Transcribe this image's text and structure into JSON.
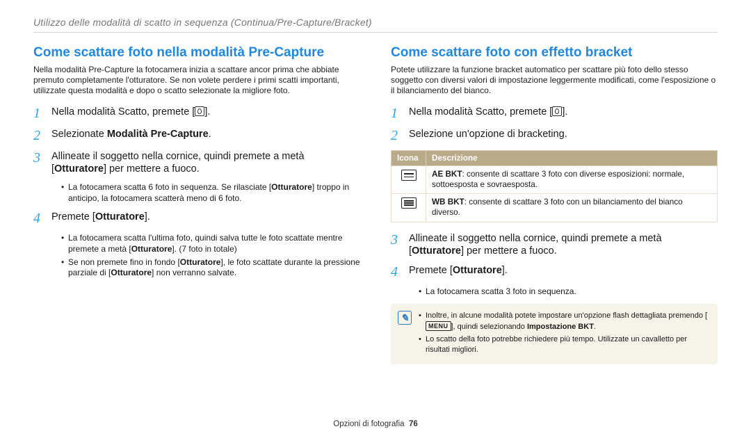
{
  "header": {
    "breadcrumb": "Utilizzo delle modalità di scatto in sequenza (Continua/Pre-Capture/Bracket)"
  },
  "left": {
    "title": "Come scattare foto nella modalità Pre-Capture",
    "intro": "Nella modalità Pre-Capture la fotocamera inizia a scattare ancor prima che abbiate premuto completamente l'otturatore. Se non volete perdere i primi scatti importanti, utilizzate questa modalità e dopo o scatto selezionate la migliore foto.",
    "steps": {
      "s1": {
        "n": "1",
        "a": "Nella modalità Scatto, premete [",
        "b": "]."
      },
      "s2": {
        "n": "2",
        "a": "Selezionate ",
        "b": "Modalità Pre-Capture",
        "c": "."
      },
      "s3": {
        "n": "3",
        "a": "Allineate il soggetto nella cornice, quindi premete a metà [",
        "b": "Otturatore",
        "c": "] per mettere a fuoco."
      },
      "s3_sub": {
        "i1_a": "La fotocamera scatta 6 foto in sequenza. Se rilasciate [",
        "i1_b": "Otturatore",
        "i1_c": "] troppo in anticipo, la fotocamera scatterà meno di 6 foto."
      },
      "s4": {
        "n": "4",
        "a": "Premete [",
        "b": "Otturatore",
        "c": "]."
      },
      "s4_sub": {
        "i1_a": "La fotocamera scatta l'ultima foto, quindi salva tutte le foto scattate mentre premete a metà [",
        "i1_b": "Otturatore",
        "i1_c": "]. (7 foto in totale)",
        "i2_a": "Se non premete fino in fondo [",
        "i2_b": "Otturatore",
        "i2_c": "], le foto scattate durante la pressione parziale di [",
        "i2_d": "Otturatore",
        "i2_e": "] non verranno salvate."
      }
    }
  },
  "right": {
    "title": "Come scattare foto con effetto bracket",
    "intro": "Potete utilizzare la funzione bracket automatico per scattare più foto dello stesso soggetto con diversi valori di impostazione leggermente modificati, come l'esposizione o il bilanciamento del bianco.",
    "steps": {
      "s1": {
        "n": "1",
        "a": "Nella modalità Scatto, premete [",
        "b": "]."
      },
      "s2": {
        "n": "2",
        "a": "Selezione un'opzione di bracketing."
      }
    },
    "table": {
      "head_icon": "Icona",
      "head_desc": "Descrizione",
      "row1_b": "AE BKT",
      "row1_t": ": consente di scattare 3 foto con diverse esposizioni: normale, sottoesposta e sovraesposta.",
      "row2_b": "WB BKT",
      "row2_t": ": consente di scattare 3 foto con un bilanciamento del bianco diverso."
    },
    "steps2": {
      "s3": {
        "n": "3",
        "a": "Allineate il soggetto nella cornice, quindi premete a metà [",
        "b": "Otturatore",
        "c": "] per mettere a fuoco."
      },
      "s4": {
        "n": "4",
        "a": "Premete [",
        "b": "Otturatore",
        "c": "]."
      },
      "s4_sub": {
        "i1": "La fotocamera scatta 3 foto in sequenza."
      }
    },
    "note": {
      "i1_a": "Inoltre, in alcune modalità potete impostare un'opzione flash dettagliata premendo [",
      "i1_menu": "MENU",
      "i1_b": "], quindi selezionando ",
      "i1_c": "Impostazione BKT",
      "i1_d": ".",
      "i2": "Lo scatto della foto potrebbe richiedere più tempo. Utilizzate un cavalletto per risultati migliori."
    }
  },
  "footer": {
    "section": "Opzioni di fotografia",
    "page": "76"
  }
}
